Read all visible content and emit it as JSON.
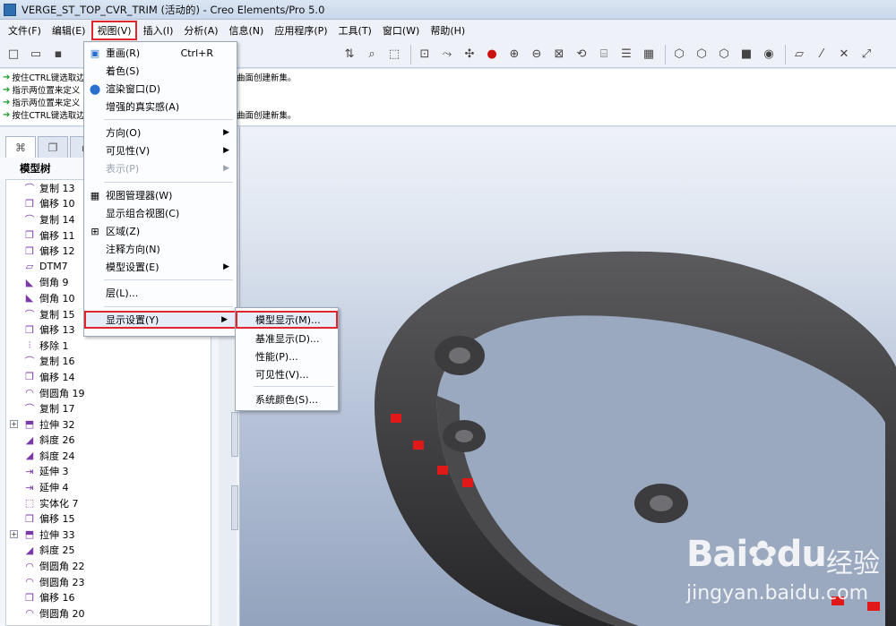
{
  "window": {
    "title": "VERGE_ST_TOP_CVR_TRIM (活动的) - Creo Elements/Pro 5.0"
  },
  "menubar": {
    "items": [
      "文件(F)",
      "编辑(E)",
      "视图(V)",
      "插入(I)",
      "分析(A)",
      "信息(N)",
      "应用程序(P)",
      "工具(T)",
      "窗口(W)",
      "帮助(H)"
    ]
  },
  "messages": {
    "lines": [
      "按住CTRL键选取边",
      "指示两位置来定义",
      "指示两位置来定义",
      "按住CTRL键选取边"
    ],
    "tail": "曲面创建新集。"
  },
  "panel": {
    "tree_title": "模型树"
  },
  "tree": {
    "items": [
      {
        "label": "复制 13",
        "icon": "copy-icon"
      },
      {
        "label": "偏移 10",
        "icon": "offset-icon"
      },
      {
        "label": "复制 14",
        "icon": "copy-icon"
      },
      {
        "label": "偏移 11",
        "icon": "offset-icon"
      },
      {
        "label": "偏移 12",
        "icon": "offset-icon"
      },
      {
        "label": "DTM7",
        "icon": "datum-plane-icon"
      },
      {
        "label": "倒角 9",
        "icon": "chamfer-icon"
      },
      {
        "label": "倒角 10",
        "icon": "chamfer-icon"
      },
      {
        "label": "复制 15",
        "icon": "copy-icon"
      },
      {
        "label": "偏移 13",
        "icon": "offset-icon"
      },
      {
        "label": "移除 1",
        "icon": "remove-icon"
      },
      {
        "label": "复制 16",
        "icon": "copy-icon"
      },
      {
        "label": "偏移 14",
        "icon": "offset-icon"
      },
      {
        "label": "倒圆角 19",
        "icon": "round-icon"
      },
      {
        "label": "复制 17",
        "icon": "copy-icon"
      },
      {
        "label": "拉伸 32",
        "icon": "extrude-icon",
        "expandable": true
      },
      {
        "label": "斜度 26",
        "icon": "draft-icon"
      },
      {
        "label": "斜度 24",
        "icon": "draft-icon"
      },
      {
        "label": "延伸 3",
        "icon": "extend-icon"
      },
      {
        "label": "延伸 4",
        "icon": "extend-icon"
      },
      {
        "label": "实体化 7",
        "icon": "solidify-icon"
      },
      {
        "label": "偏移 15",
        "icon": "offset-icon"
      },
      {
        "label": "拉伸 33",
        "icon": "extrude-icon",
        "expandable": true
      },
      {
        "label": "斜度 25",
        "icon": "draft-icon"
      },
      {
        "label": "倒圆角 22",
        "icon": "round-icon"
      },
      {
        "label": "倒圆角 23",
        "icon": "round-icon"
      },
      {
        "label": "偏移 16",
        "icon": "offset-icon"
      },
      {
        "label": "倒圆角 20",
        "icon": "round-icon"
      }
    ]
  },
  "view_menu": {
    "items": [
      {
        "label": "重画(R)",
        "shortcut": "Ctrl+R",
        "icon": "repaint-icon"
      },
      {
        "label": "着色(S)"
      },
      {
        "label": "渲染窗口(D)",
        "icon": "render-icon"
      },
      {
        "label": "增强的真实感(A)"
      },
      {
        "label": "方向(O)",
        "submenu": true
      },
      {
        "label": "可见性(V)",
        "submenu": true
      },
      {
        "label": "表示(P)",
        "submenu": true,
        "disabled": true
      },
      {
        "label": "视图管理器(W)",
        "icon": "view-manager-icon"
      },
      {
        "label": "显示组合视图(C)"
      },
      {
        "label": "区域(Z)",
        "icon": "zone-icon"
      },
      {
        "label": "注释方向(N)"
      },
      {
        "label": "模型设置(E)",
        "submenu": true
      },
      {
        "label": "层(L)..."
      },
      {
        "label": "显示设置(Y)",
        "submenu": true,
        "highlight": true
      }
    ]
  },
  "display_submenu": {
    "items": [
      {
        "label": "模型显示(M)...",
        "highlight": true
      },
      {
        "label": "基准显示(D)..."
      },
      {
        "label": "性能(P)..."
      },
      {
        "label": "可见性(V)..."
      },
      {
        "label": "系统颜色(S)..."
      }
    ]
  },
  "watermark": {
    "logo": "Bai",
    "logo2": "du",
    "text": "经验",
    "url": "jingyan.baidu.com"
  }
}
